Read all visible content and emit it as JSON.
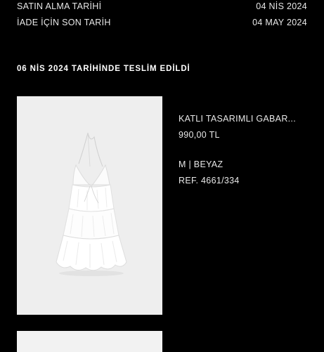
{
  "order": {
    "purchase_label": "SATIN ALMA TARİHİ",
    "purchase_date": "04 NİS 2024",
    "return_label": "İADE İÇİN SON TARİH",
    "return_date": "04 MAY 2024",
    "delivered_text": "06 NİS 2024 TARİHİNDE TESLİM EDİLDİ"
  },
  "product": {
    "name": "KATLI TASARIMLI GABAR...",
    "price": "990,00 TL",
    "variant": "M | BEYAZ",
    "ref": "REF. 4661/334",
    "image": "white-tiered-mini-dress-photo"
  },
  "colors": {
    "background": "#000000",
    "text": "#ffffff",
    "image_background": "#eeeeee"
  }
}
